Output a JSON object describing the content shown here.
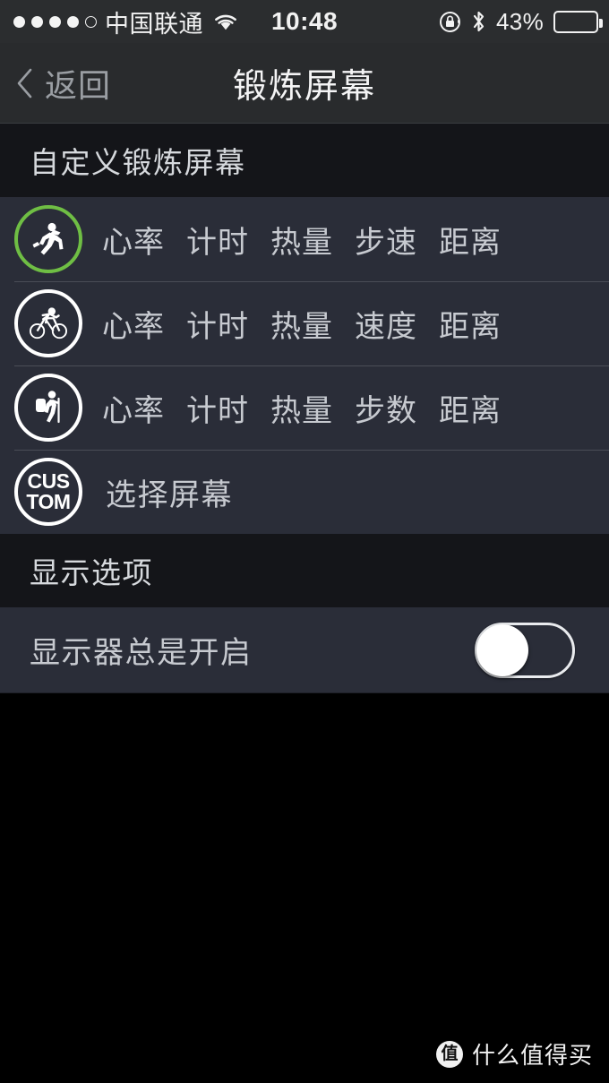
{
  "statusbar": {
    "signal_dots_filled": 4,
    "signal_dots_total": 5,
    "carrier": "中国联通",
    "wifi_icon": "wifi-icon",
    "time": "10:48",
    "rotation_lock_icon": "rotation-lock-icon",
    "bluetooth_icon": "bluetooth-icon",
    "battery_percent": "43%"
  },
  "navbar": {
    "back_icon": "chevron-left-icon",
    "back_label": "返回",
    "title": "锻炼屏幕"
  },
  "sections": {
    "custom_screens_header": "自定义锻炼屏幕",
    "display_options_header": "显示选项"
  },
  "activities": [
    {
      "icon": "running-icon",
      "icon_color": "#6fbe44",
      "selected": true,
      "metrics": [
        "心率",
        "计时",
        "热量",
        "步速",
        "距离"
      ]
    },
    {
      "icon": "cycling-icon",
      "icon_color": "#ffffff",
      "selected": false,
      "metrics": [
        "心率",
        "计时",
        "热量",
        "速度",
        "距离"
      ]
    },
    {
      "icon": "hiking-icon",
      "icon_color": "#ffffff",
      "selected": false,
      "metrics": [
        "心率",
        "计时",
        "热量",
        "步数",
        "距离"
      ]
    }
  ],
  "custom_row": {
    "icon": "custom-badge-icon",
    "icon_text_line1": "CUS",
    "icon_text_line2": "TOM",
    "label": "选择屏幕"
  },
  "display_options": {
    "always_on_label": "显示器总是开启",
    "always_on_value": "off"
  },
  "watermark": {
    "logo_char": "值",
    "text": "什么值得买"
  },
  "colors": {
    "accent_green": "#6fbe44",
    "row_background": "#2a2d38",
    "section_background": "#141519",
    "navbar_background": "#292b2d",
    "text_primary": "#f4f4f5",
    "text_secondary": "#c7cad0"
  }
}
